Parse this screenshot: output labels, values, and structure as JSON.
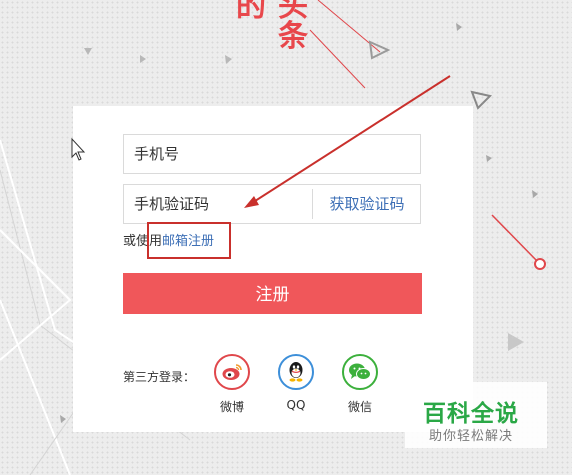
{
  "brand": {
    "line1_a": "的",
    "line1_b": "头",
    "line2": "条"
  },
  "form": {
    "phone_placeholder": "手机号",
    "code_placeholder": "手机验证码",
    "get_code_label": "获取验证码",
    "alt_prefix": "或使用",
    "email_register_link": "邮箱注册",
    "register_button": "注册"
  },
  "third_party": {
    "label": "第三方登录：",
    "items": [
      {
        "name": "微博",
        "icon": "weibo-icon",
        "color": "#e0474b"
      },
      {
        "name": "QQ",
        "icon": "qq-icon",
        "color": "#3d8fd9"
      },
      {
        "name": "微信",
        "icon": "wechat-icon",
        "color": "#3cb03c"
      }
    ]
  },
  "watermark": {
    "title": "百科全说",
    "subtitle": "助你轻松解决"
  },
  "colors": {
    "accent": "#f0575a",
    "link": "#3d6fb6",
    "annotation": "#c9302c"
  }
}
